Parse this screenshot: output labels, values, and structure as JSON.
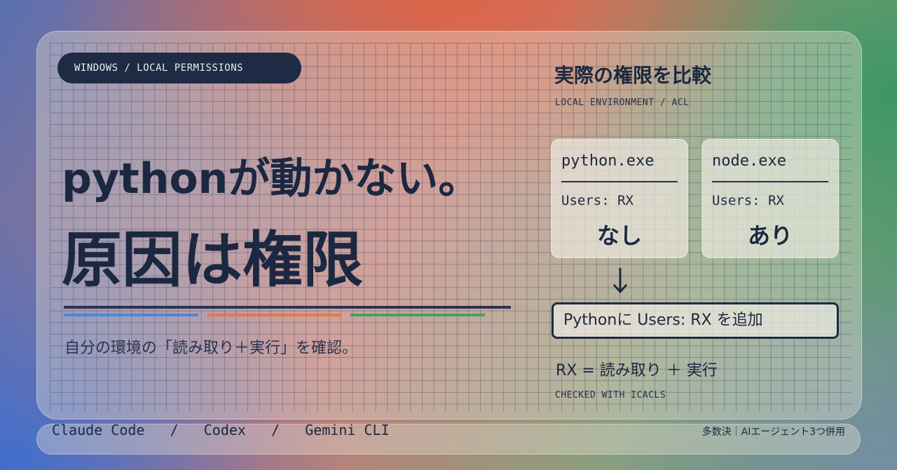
{
  "tag": "WINDOWS / LOCAL PERMISSIONS",
  "headline": {
    "line1": "pythonが動かない。",
    "line2": "原因は権限"
  },
  "subtext": "自分の環境の「読み取り＋実行」を確認。",
  "accent_colors": {
    "dark": "#2a3350",
    "blue": "#4a86d8",
    "orange": "#e07a4a",
    "green": "#3fa46e"
  },
  "panel": {
    "title": "実際の権限を比較",
    "subtitle": "LOCAL ENVIRONMENT / ACL",
    "cards": [
      {
        "name": "python.exe",
        "permission": "Users: RX",
        "status": "なし"
      },
      {
        "name": "node.exe",
        "permission": "Users: RX",
        "status": "あり"
      }
    ],
    "arrow_icon": "arrow-down-icon",
    "fix": "Pythonに Users: RX を追加",
    "rx_note": "RX = 読み取り ＋ 実行",
    "checked": "CHECKED WITH ICACLS"
  },
  "footer": {
    "tools": "Claude Code   /   Codex   /   Gemini CLI",
    "note": "多数決｜AIエージェント3つ併用"
  }
}
